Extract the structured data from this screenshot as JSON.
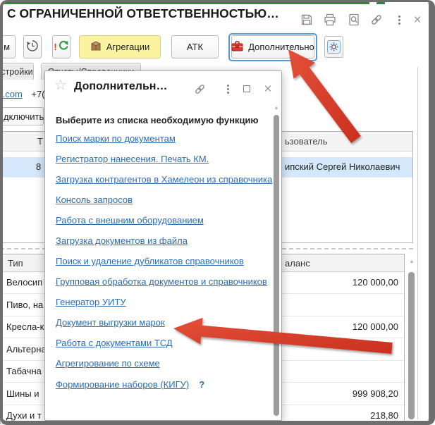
{
  "colors": {
    "green_bar": "#2e8b3e",
    "link_blue": "#2b6cb5",
    "selection_blue": "#d5e8fb",
    "highlight_yellow": "#fbf3a0",
    "arrow_red": "#d9422e",
    "toolbox_red": "#e03a2f",
    "focus_ring_blue": "#569ade"
  },
  "titlebar": {
    "title": "С ОГРАНИЧЕННОЙ ОТВЕТСТВЕННОСТЬЮ…"
  },
  "toolbar": {
    "partial_button_label": "м",
    "refresh_exclamation": "!",
    "aggregations_label": "Агрегации",
    "atk_label": "АТК",
    "additional_label": "Дополнительно"
  },
  "tabs": {
    "tab1_fragment": "стройки",
    "tab2_label": "Отчеты/Справочники"
  },
  "contacts": {
    "email_fragment": "r.com",
    "phone_fragment": "+7("
  },
  "connect_button_fragment": "дключить",
  "users_table": {
    "header_fragment_left": "Т",
    "header_fragment_right": "ьзователь",
    "selected_row_cell_fragment": "8",
    "selected_user_fragment": "ипский Сергей Николаевич"
  },
  "goods_table": {
    "type_header": "Тип",
    "balance_header_fragment": "аланс",
    "rows": [
      {
        "type": "Велосип",
        "balance": "120 000,00"
      },
      {
        "type": "Пиво, на",
        "balance": ""
      },
      {
        "type": "Кресла-к",
        "balance": "120 000,00"
      },
      {
        "type": "Альтерна",
        "balance": ""
      },
      {
        "type": "Табачна",
        "balance": ""
      },
      {
        "type": "Шины и",
        "balance": "999 908,20"
      },
      {
        "type": "Духи и т",
        "balance": "218,80"
      }
    ]
  },
  "popup": {
    "title": "Дополнительн…",
    "instruction": "Выберите из списка необходимую функцию",
    "links": [
      "Поиск марки по документам",
      "Регистратор нанесения. Печать КМ.",
      "Загрузка контрагентов в Хамелеон из справочника",
      "Консоль запросов",
      "Работа с внешним оборудованием",
      "Загрузка документов из файла",
      "Поиск и удаление дубликатов справочников",
      "Групповая обработка документов и справочников",
      "Генератор УИТУ",
      "Документ выгрузки марок",
      "Работа с документами ТСД",
      "Агрегирование по схеме",
      "Формирование наборов (КИГУ)"
    ],
    "help_label": "?"
  },
  "glyphs": {
    "star": "☆",
    "close": "×",
    "scroll_up": "▲"
  }
}
